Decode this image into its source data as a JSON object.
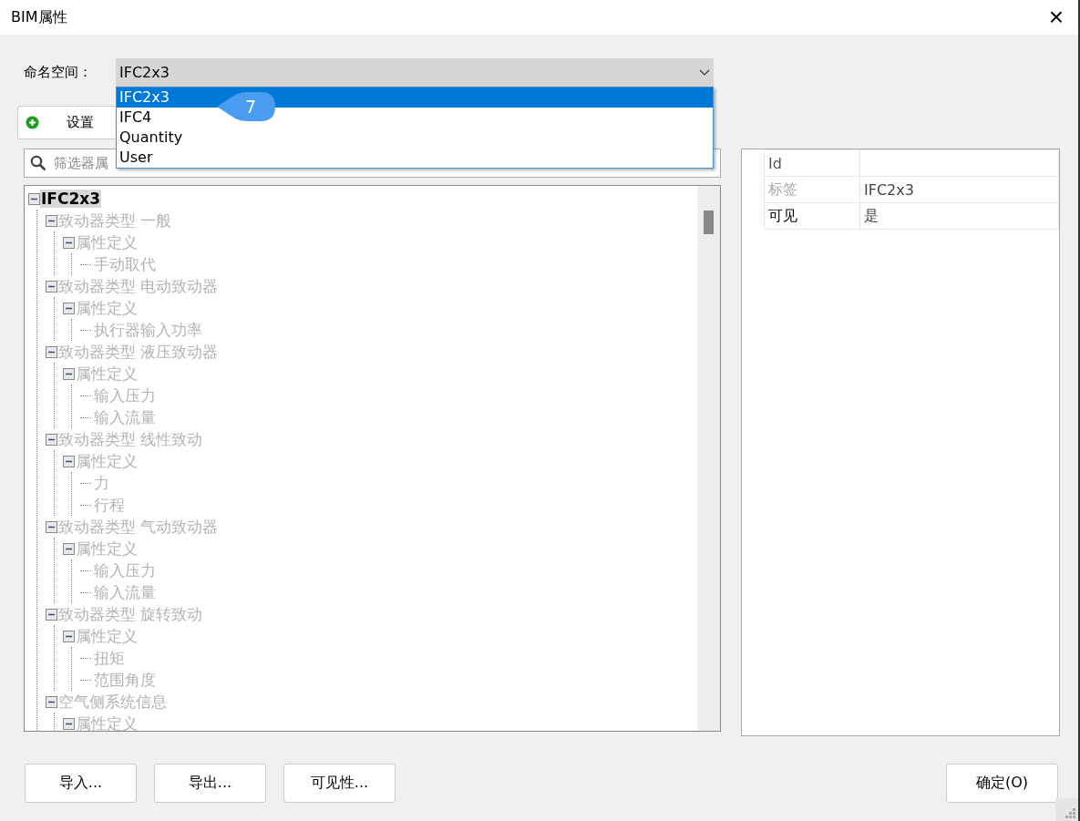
{
  "window": {
    "title": "BIM属性",
    "close": "×"
  },
  "namespace": {
    "label": "命名空间：",
    "value": "IFC2x3",
    "expanded": true,
    "options": [
      {
        "label": "IFC2x3",
        "selected": true
      },
      {
        "label": "IFC4",
        "selected": false
      },
      {
        "label": "Quantity",
        "selected": false
      },
      {
        "label": "User",
        "selected": false
      }
    ]
  },
  "callout": {
    "label": "7"
  },
  "settings_button": {
    "label": "设置"
  },
  "filter": {
    "placeholder": "筛选器属"
  },
  "tree": [
    {
      "label": "IFC2x3",
      "selected": true,
      "disabled": false,
      "expanded": true,
      "children": [
        {
          "label": "致动器类型 一般",
          "selected": false,
          "disabled": true,
          "expanded": true,
          "children": [
            {
              "label": "属性定义",
              "selected": false,
              "disabled": true,
              "expanded": true,
              "children": [
                {
                  "label": "手动取代",
                  "selected": false,
                  "disabled": true
                }
              ]
            }
          ]
        },
        {
          "label": "致动器类型 电动致动器",
          "selected": false,
          "disabled": true,
          "expanded": true,
          "children": [
            {
              "label": "属性定义",
              "selected": false,
              "disabled": true,
              "expanded": true,
              "children": [
                {
                  "label": "执行器输入功率",
                  "selected": false,
                  "disabled": true
                }
              ]
            }
          ]
        },
        {
          "label": "致动器类型 液压致动器",
          "selected": false,
          "disabled": true,
          "expanded": true,
          "children": [
            {
              "label": "属性定义",
              "selected": false,
              "disabled": true,
              "expanded": true,
              "children": [
                {
                  "label": "输入压力",
                  "selected": false,
                  "disabled": true
                },
                {
                  "label": "输入流量",
                  "selected": false,
                  "disabled": true
                }
              ]
            }
          ]
        },
        {
          "label": "致动器类型 线性致动",
          "selected": false,
          "disabled": true,
          "expanded": true,
          "children": [
            {
              "label": "属性定义",
              "selected": false,
              "disabled": true,
              "expanded": true,
              "children": [
                {
                  "label": "力",
                  "selected": false,
                  "disabled": true
                },
                {
                  "label": "行程",
                  "selected": false,
                  "disabled": true
                }
              ]
            }
          ]
        },
        {
          "label": "致动器类型 气动致动器",
          "selected": false,
          "disabled": true,
          "expanded": true,
          "children": [
            {
              "label": "属性定义",
              "selected": false,
              "disabled": true,
              "expanded": true,
              "children": [
                {
                  "label": "输入压力",
                  "selected": false,
                  "disabled": true
                },
                {
                  "label": "输入流量",
                  "selected": false,
                  "disabled": true
                }
              ]
            }
          ]
        },
        {
          "label": "致动器类型 旋转致动",
          "selected": false,
          "disabled": true,
          "expanded": true,
          "children": [
            {
              "label": "属性定义",
              "selected": false,
              "disabled": true,
              "expanded": true,
              "children": [
                {
                  "label": "扭矩",
                  "selected": false,
                  "disabled": true
                },
                {
                  "label": "范围角度",
                  "selected": false,
                  "disabled": true
                }
              ]
            }
          ]
        },
        {
          "label": "空气侧系统信息",
          "selected": false,
          "disabled": true,
          "expanded": true,
          "children": [
            {
              "label": "属性定义",
              "selected": false,
              "disabled": true,
              "expanded": true
            }
          ]
        }
      ]
    }
  ],
  "properties": [
    {
      "name": "Id",
      "disabled": false
    },
    {
      "name": "标签",
      "value": "IFC2x3",
      "disabled": true
    },
    {
      "name": "可见",
      "value": "是",
      "disabled": false
    }
  ],
  "buttons": [
    "导入...",
    "导出...",
    "可见性..."
  ],
  "ok_button": "确定(O)"
}
